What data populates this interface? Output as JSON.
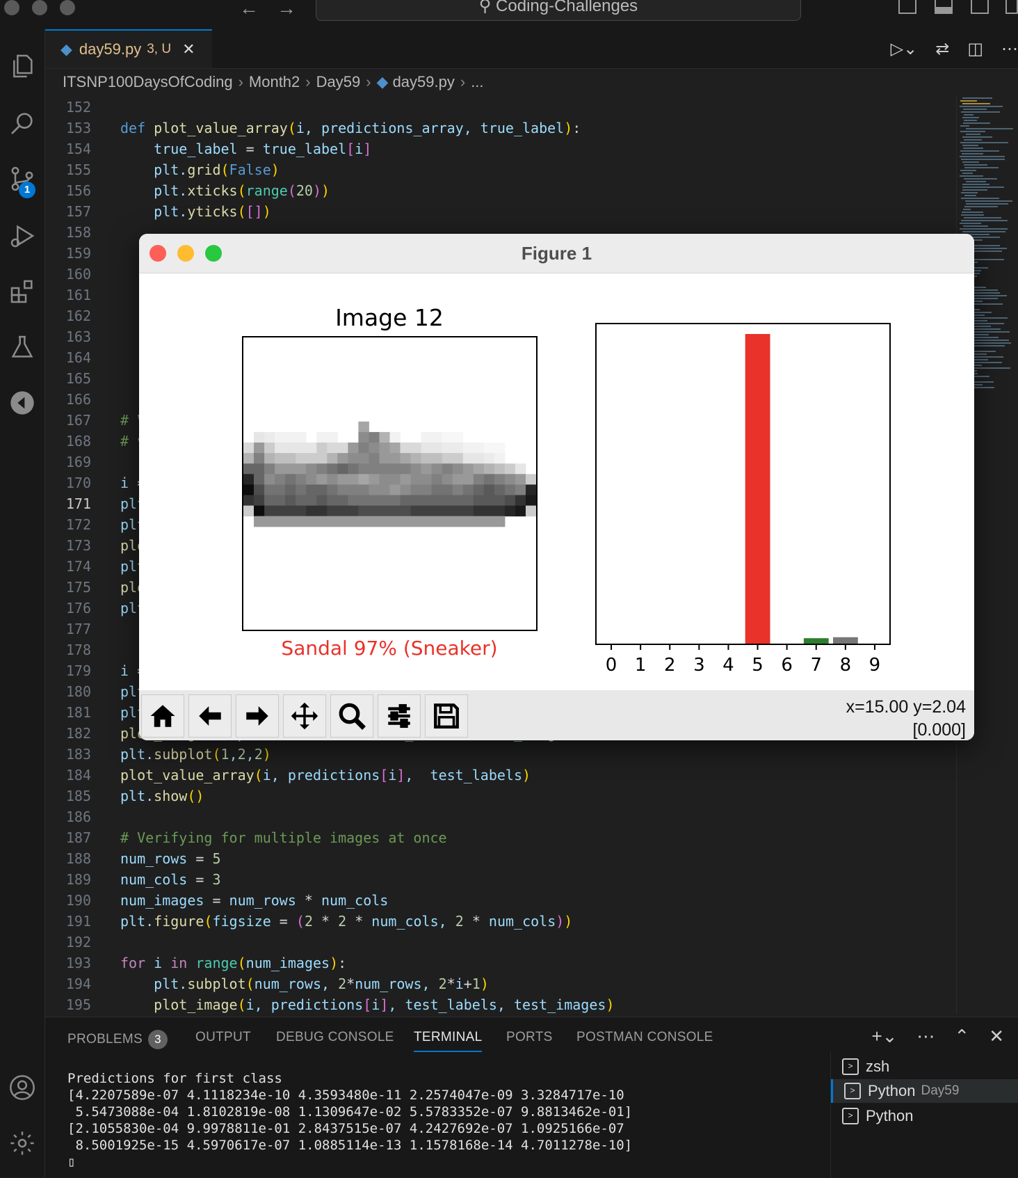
{
  "window": {
    "command_center": "Coding-Challenges"
  },
  "tab": {
    "filename": "day59.py",
    "status": "3, U"
  },
  "breadcrumb": [
    "ITSNP100DaysOfCoding",
    "Month2",
    "Day59",
    "day59.py",
    "..."
  ],
  "scm_badge": "1",
  "code_lines": [
    {
      "n": "152",
      "html": ""
    },
    {
      "n": "153",
      "html": "<span class='kw'>def</span> <span class='fn'>plot_value_array</span><span class='pn'>(</span>i, predictions_array, true_label<span class='pn'>)</span><span class='op'>:</span>"
    },
    {
      "n": "154",
      "html": "    true_label <span class='op'>=</span> true_label<span class='pn2'>[</span>i<span class='pn2'>]</span>"
    },
    {
      "n": "155",
      "html": "    plt.<span class='fn'>grid</span><span class='pn'>(</span><span class='kw'>False</span><span class='pn'>)</span>"
    },
    {
      "n": "156",
      "html": "    plt.<span class='fn'>xticks</span><span class='pn'>(</span><span class='bi'>range</span><span class='pn2'>(</span><span class='nm'>20</span><span class='pn2'>)</span><span class='pn'>)</span>"
    },
    {
      "n": "157",
      "html": "    plt.<span class='fn'>yticks</span><span class='pn'>(</span><span class='pn2'>[]</span><span class='pn'>)</span>"
    },
    {
      "n": "158",
      "html": ""
    },
    {
      "n": "159",
      "html": ""
    },
    {
      "n": "160",
      "html": ""
    },
    {
      "n": "161",
      "html": ""
    },
    {
      "n": "162",
      "html": ""
    },
    {
      "n": "163",
      "html": ""
    },
    {
      "n": "164",
      "html": ""
    },
    {
      "n": "165",
      "html": ""
    },
    {
      "n": "166",
      "html": ""
    },
    {
      "n": "167",
      "html": "<span class='cm'># V</span>"
    },
    {
      "n": "168",
      "html": "<span class='cm'># v</span>"
    },
    {
      "n": "169",
      "html": ""
    },
    {
      "n": "170",
      "html": "i <span class='op'>=</span>"
    },
    {
      "n": "171",
      "html": "plt"
    },
    {
      "n": "172",
      "html": "plt"
    },
    {
      "n": "173",
      "html": "<span class='fn'>plo</span>"
    },
    {
      "n": "174",
      "html": "plt"
    },
    {
      "n": "175",
      "html": "<span class='fn'>plo</span>"
    },
    {
      "n": "176",
      "html": "plt"
    },
    {
      "n": "177",
      "html": ""
    },
    {
      "n": "178",
      "html": ""
    },
    {
      "n": "179",
      "html": "i <span class='op'>=</span>"
    },
    {
      "n": "180",
      "html": "plt"
    },
    {
      "n": "181",
      "html": "plt"
    },
    {
      "n": "182",
      "html": "<span class='fn'>plot_image</span><span class='pn'>(</span>i, predictions<span class='pn2'>[</span>i<span class='pn2'>]</span>, test_labels, test_images<span class='pn'>)</span>"
    },
    {
      "n": "183",
      "html": "plt.<span class='fn'>subplot</span><span class='pn'>(</span><span class='nm'>1</span>,<span class='nm'>2</span>,<span class='nm'>2</span><span class='pn'>)</span>"
    },
    {
      "n": "184",
      "html": "<span class='fn'>plot_value_array</span><span class='pn'>(</span>i, predictions<span class='pn2'>[</span>i<span class='pn2'>]</span>,  test_labels<span class='pn'>)</span>"
    },
    {
      "n": "185",
      "html": "plt.<span class='fn'>show</span><span class='pn'>()</span>"
    },
    {
      "n": "186",
      "html": ""
    },
    {
      "n": "187",
      "html": "<span class='cm'># Verifying for multiple images at once</span>"
    },
    {
      "n": "188",
      "html": "num_rows <span class='op'>=</span> <span class='nm'>5</span>"
    },
    {
      "n": "189",
      "html": "num_cols <span class='op'>=</span> <span class='nm'>3</span>"
    },
    {
      "n": "190",
      "html": "num_images <span class='op'>=</span> num_rows <span class='op'>*</span> num_cols"
    },
    {
      "n": "191",
      "html": "plt.<span class='fn'>figure</span><span class='pn'>(</span>figsize <span class='op'>=</span> <span class='pn2'>(</span><span class='nm'>2</span> <span class='op'>*</span> <span class='nm'>2</span> <span class='op'>*</span> num_cols, <span class='nm'>2</span> <span class='op'>*</span> num_cols<span class='pn2'>)</span><span class='pn'>)</span>"
    },
    {
      "n": "192",
      "html": ""
    },
    {
      "n": "193",
      "html": "<span class='ct'>for</span> i <span class='ct'>in</span> <span class='bi'>range</span><span class='pn'>(</span>num_images<span class='pn'>)</span><span class='op'>:</span>"
    },
    {
      "n": "194",
      "html": "    plt.<span class='fn'>subplot</span><span class='pn'>(</span>num_rows, <span class='nm'>2</span><span class='op'>*</span>num_rows, <span class='nm'>2</span><span class='op'>*</span>i<span class='op'>+</span><span class='nm'>1</span><span class='pn'>)</span>"
    },
    {
      "n": "195",
      "html": "    <span class='fn'>plot_image</span><span class='pn'>(</span>i, predictions<span class='pn2'>[</span>i<span class='pn2'>]</span>, test_labels, test_images<span class='pn'>)</span>"
    }
  ],
  "current_line": "171",
  "figure": {
    "title": "Figure 1",
    "image_title": "Image 12",
    "image_caption": "Sandal 97% (Sneaker)",
    "caption_color": "#e8322a",
    "coords_line1": "x=15.00 y=2.04",
    "coords_line2": "[0.000]",
    "toolbar": [
      "home-icon",
      "back-icon",
      "forward-icon",
      "pan-icon",
      "zoom-icon",
      "configure-subplots-icon",
      "save-icon"
    ]
  },
  "chart_data": {
    "type": "bar",
    "categories": [
      "0",
      "1",
      "2",
      "3",
      "4",
      "5",
      "6",
      "7",
      "8",
      "9"
    ],
    "values": [
      0.0,
      0.0,
      0.0,
      0.0,
      0.0,
      0.97,
      0.0,
      0.017,
      0.02,
      0.0
    ],
    "colors": [
      "#777777",
      "#777777",
      "#777777",
      "#777777",
      "#777777",
      "#e8322a",
      "#777777",
      "#2e7d2e",
      "#777777",
      "#777777"
    ],
    "ylim": [
      0,
      1
    ],
    "title": "",
    "xlabel": "",
    "ylabel": ""
  },
  "panel": {
    "tabs": [
      "PROBLEMS",
      "OUTPUT",
      "DEBUG CONSOLE",
      "TERMINAL",
      "PORTS",
      "POSTMAN CONSOLE"
    ],
    "problems_count": "3",
    "active_tab": "TERMINAL",
    "terminal_lines": [
      "Predictions for first class",
      "[4.2207589e-07 4.1118234e-10 4.3593480e-11 2.2574047e-09 3.3284717e-10",
      " 5.5473088e-04 1.8102819e-08 1.1309647e-02 5.5783352e-07 9.8813462e-01]",
      "[2.1055830e-04 9.9978811e-01 2.8437515e-07 4.2427692e-07 1.0925166e-07",
      " 8.5001925e-15 4.5970617e-07 1.0885114e-13 1.1578168e-14 4.7011278e-10]",
      "▯"
    ],
    "terminals": [
      {
        "name": "zsh",
        "sub": ""
      },
      {
        "name": "Python",
        "sub": "Day59"
      },
      {
        "name": "Python",
        "sub": ""
      }
    ]
  }
}
